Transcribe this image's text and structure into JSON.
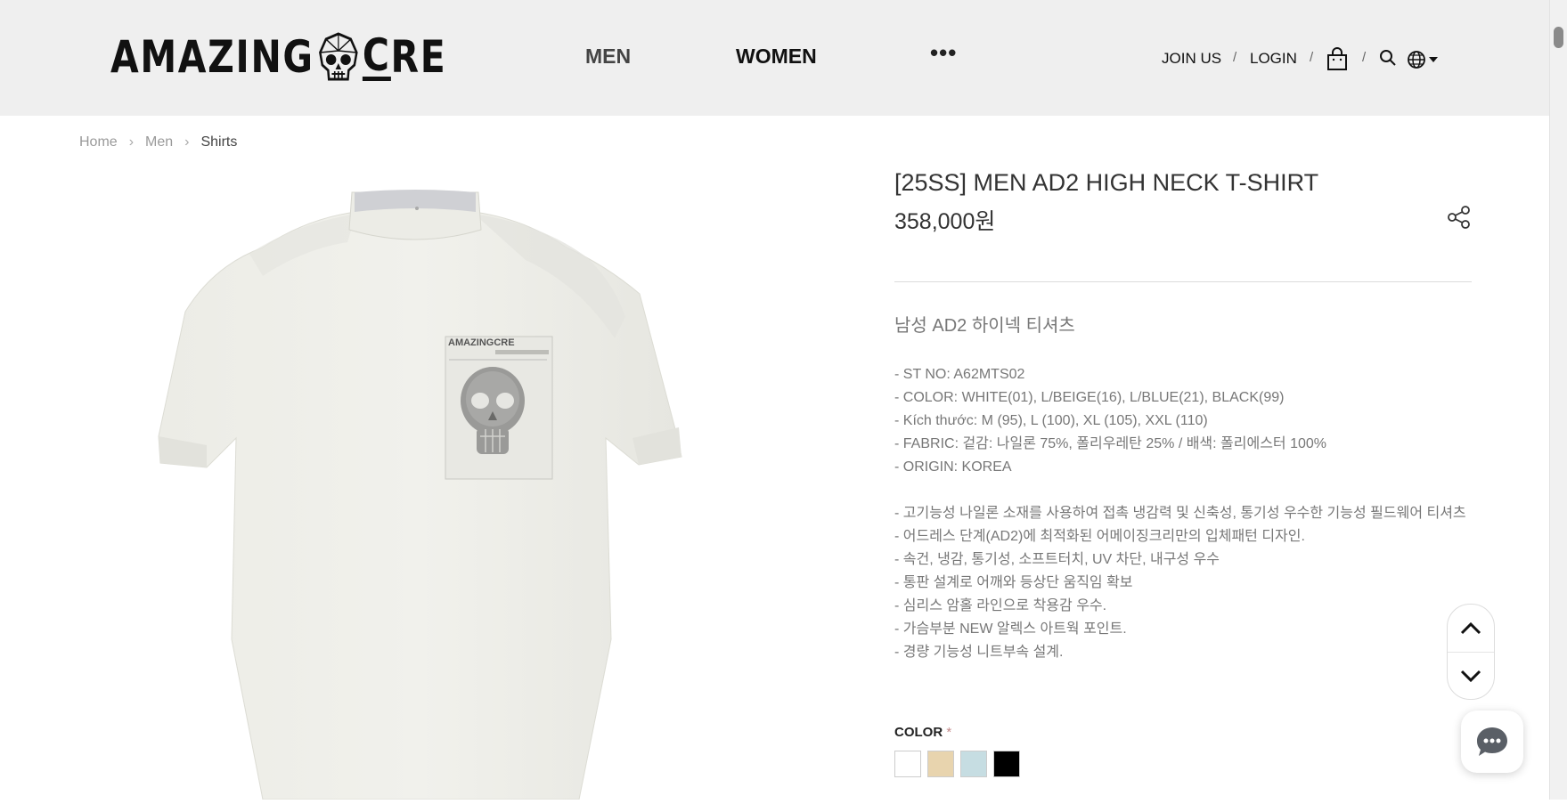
{
  "header": {
    "logo_text_left": "AMAZING",
    "logo_text_right": "RE",
    "logo_o": "C",
    "nav": [
      {
        "label": "MEN"
      },
      {
        "label": "WOMEN"
      },
      {
        "label": "•••"
      }
    ],
    "join_label": "JOIN US",
    "login_label": "LOGIN",
    "separator": "/",
    "icons": [
      "cart-icon",
      "search-icon",
      "globe-icon",
      "caret-down-icon"
    ]
  },
  "breadcrumb": [
    "Home",
    "Men",
    "Shirts"
  ],
  "product": {
    "title": "[25SS] MEN AD2 HIGH NECK T-SHIRT",
    "price": "358,000원",
    "subtitle": "남성 AD2 하이넥 티셔츠",
    "image_print_text": "AMAZINGCRE",
    "specs": [
      "- ST NO: A62MTS02",
      "- COLOR: WHITE(01), L/BEIGE(16), L/BLUE(21), BLACK(99)",
      "- Kích thước: M (95), L (100), XL (105), XXL (110)",
      "- FABRIC: 겉감: 나일론 75%, 폴리우레탄 25% / 배색: 폴리에스터 100%",
      "- ORIGIN: KOREA"
    ],
    "features": [
      "- 고기능성 나일론 소재를 사용하여 접촉 냉감력 및 신축성, 통기성 우수한 기능성 필드웨어 티셔츠",
      "- 어드레스 단계(AD2)에 최적화된 어메이징크리만의 입체패턴 디자인.",
      "- 속건, 냉감, 통기성, 소프트터치, UV 차단, 내구성 우수",
      "- 통판 설계로 어깨와 등상단 움직임 확보",
      "- 심리스 암홀 라인으로 착용감 우수.",
      "- 가슴부분 NEW 알렉스 아트웍 포인트.",
      "- 경량 기능성 니트부속 설계."
    ],
    "color_label": "COLOR",
    "required_mark": "*",
    "colors": [
      {
        "name": "WHITE",
        "hex": "#ffffff"
      },
      {
        "name": "L/BEIGE",
        "hex": "#e8d4ae"
      },
      {
        "name": "L/BLUE",
        "hex": "#c6dde2"
      },
      {
        "name": "BLACK",
        "hex": "#000000"
      }
    ]
  }
}
